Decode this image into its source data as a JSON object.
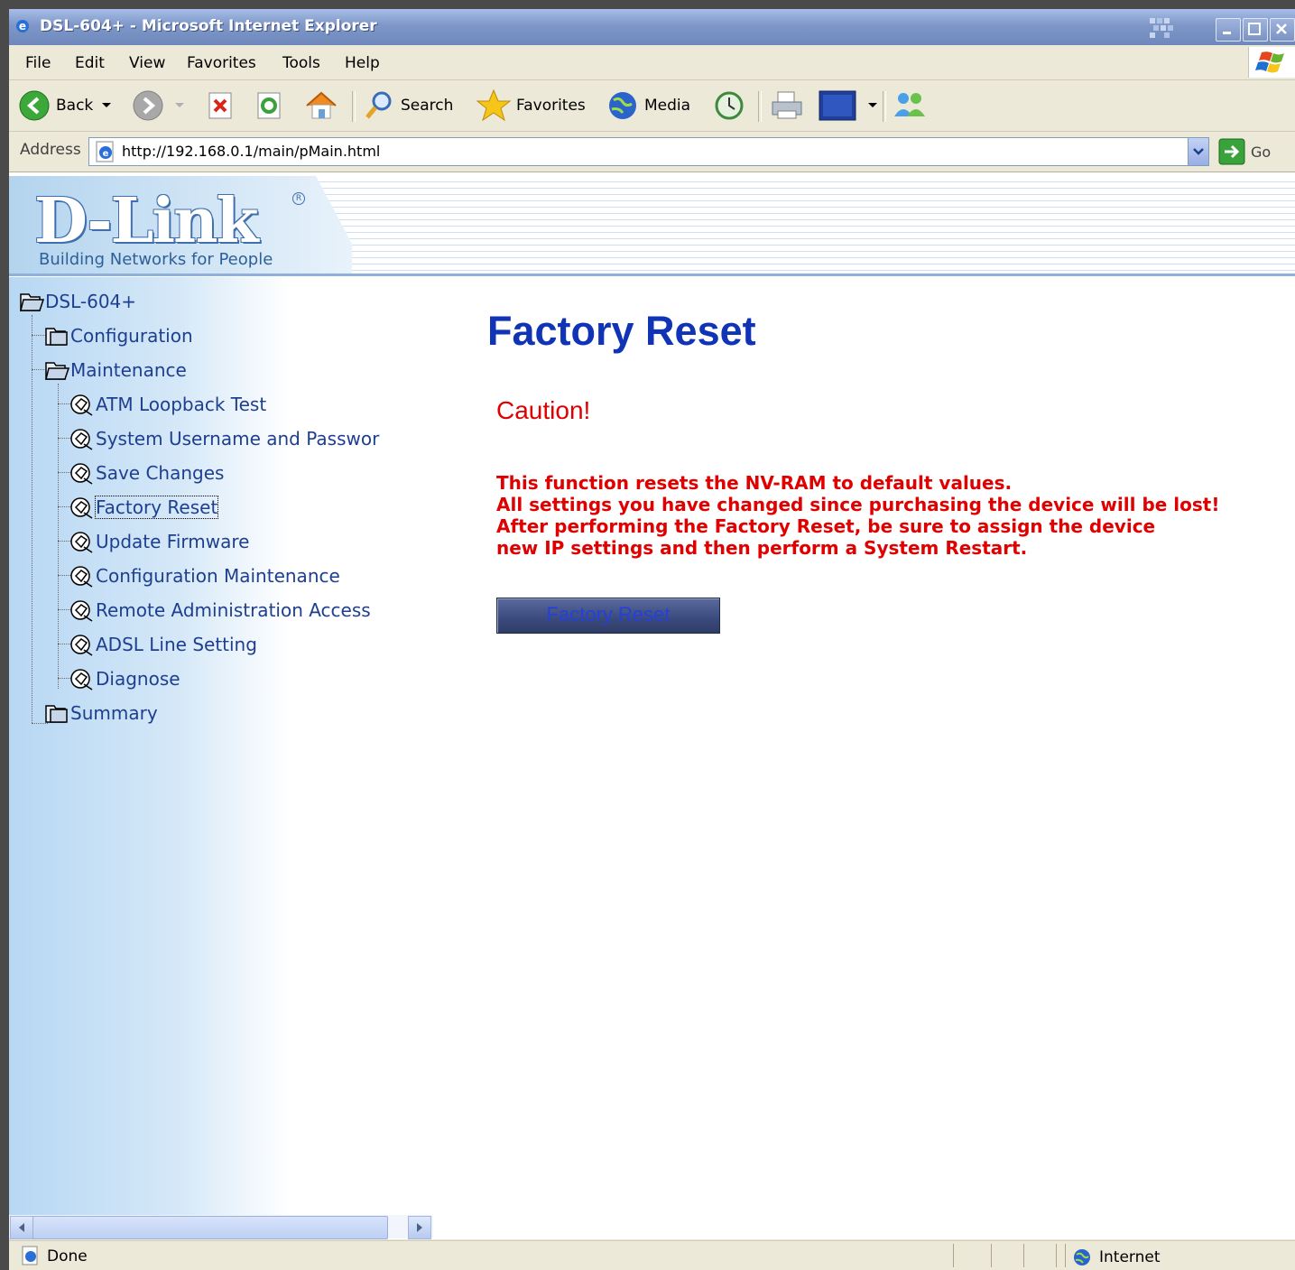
{
  "window": {
    "title": "DSL-604+ - Microsoft Internet Explorer"
  },
  "menubar": {
    "items": [
      "File",
      "Edit",
      "View",
      "Favorites",
      "Tools",
      "Help"
    ]
  },
  "toolbar": {
    "back_label": "Back",
    "search_label": "Search",
    "favorites_label": "Favorites",
    "media_label": "Media"
  },
  "address": {
    "label": "Address",
    "url": "http://192.168.0.1/main/pMain.html",
    "go_label": "Go"
  },
  "banner": {
    "logo_text": "D-Link",
    "tagline": "Building Networks for People"
  },
  "tree": {
    "root": "DSL-604+",
    "configuration": "Configuration",
    "maintenance": "Maintenance",
    "maintenance_items": [
      "ATM Loopback Test",
      "System Username and Passwor",
      "Save Changes",
      "Factory Reset",
      "Update Firmware",
      "Configuration Maintenance",
      "Remote Administration Access",
      "ADSL Line Setting",
      "Diagnose"
    ],
    "summary": "Summary",
    "selected": "Factory Reset"
  },
  "content": {
    "title": "Factory Reset",
    "caution": "Caution!",
    "warning_lines": [
      "This function resets the NV-RAM to default values.",
      "All settings you have changed since purchasing the device will be lost!",
      "After performing the Factory Reset, be sure to assign the device",
      "new IP settings and then perform a System Restart."
    ],
    "button_label": "Factory Reset"
  },
  "statusbar": {
    "status": "Done",
    "zone": "Internet"
  },
  "colors": {
    "title_blue": "#1133b6",
    "warning_red": "#e00000",
    "tree_text": "#1e3f8f"
  }
}
